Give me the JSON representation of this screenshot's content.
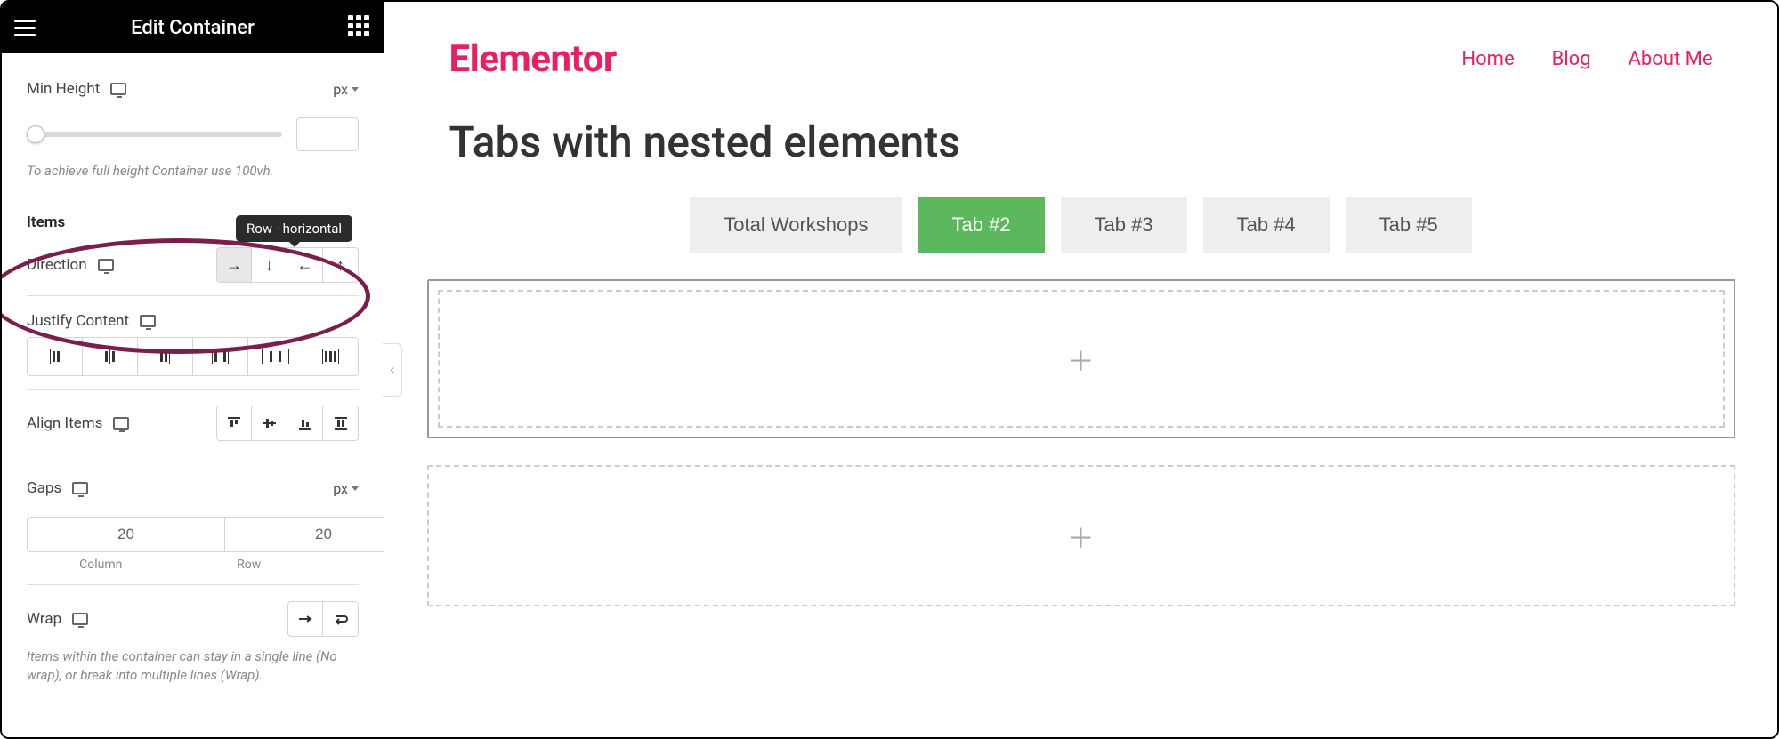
{
  "panel": {
    "title": "Edit Container",
    "min_height": {
      "label": "Min Height",
      "unit": "px",
      "value": "",
      "hint": "To achieve full height Container use 100vh."
    },
    "items_section": "Items",
    "direction": {
      "label": "Direction",
      "tooltip": "Row - horizontal",
      "options": [
        "row",
        "column",
        "row-reverse",
        "column-reverse"
      ],
      "active": "row"
    },
    "justify": {
      "label": "Justify Content"
    },
    "align": {
      "label": "Align Items"
    },
    "gaps": {
      "label": "Gaps",
      "unit": "px",
      "column": "20",
      "row": "20",
      "column_label": "Column",
      "row_label": "Row"
    },
    "wrap": {
      "label": "Wrap",
      "hint": "Items within the container can stay in a single line (No wrap), or break into multiple lines (Wrap)."
    }
  },
  "preview": {
    "brand": "Elementor",
    "nav": [
      "Home",
      "Blog",
      "About Me"
    ],
    "heading": "Tabs with nested elements",
    "tabs": [
      "Total Workshops",
      "Tab #2",
      "Tab #3",
      "Tab #4",
      "Tab #5"
    ],
    "active_tab": 1
  }
}
